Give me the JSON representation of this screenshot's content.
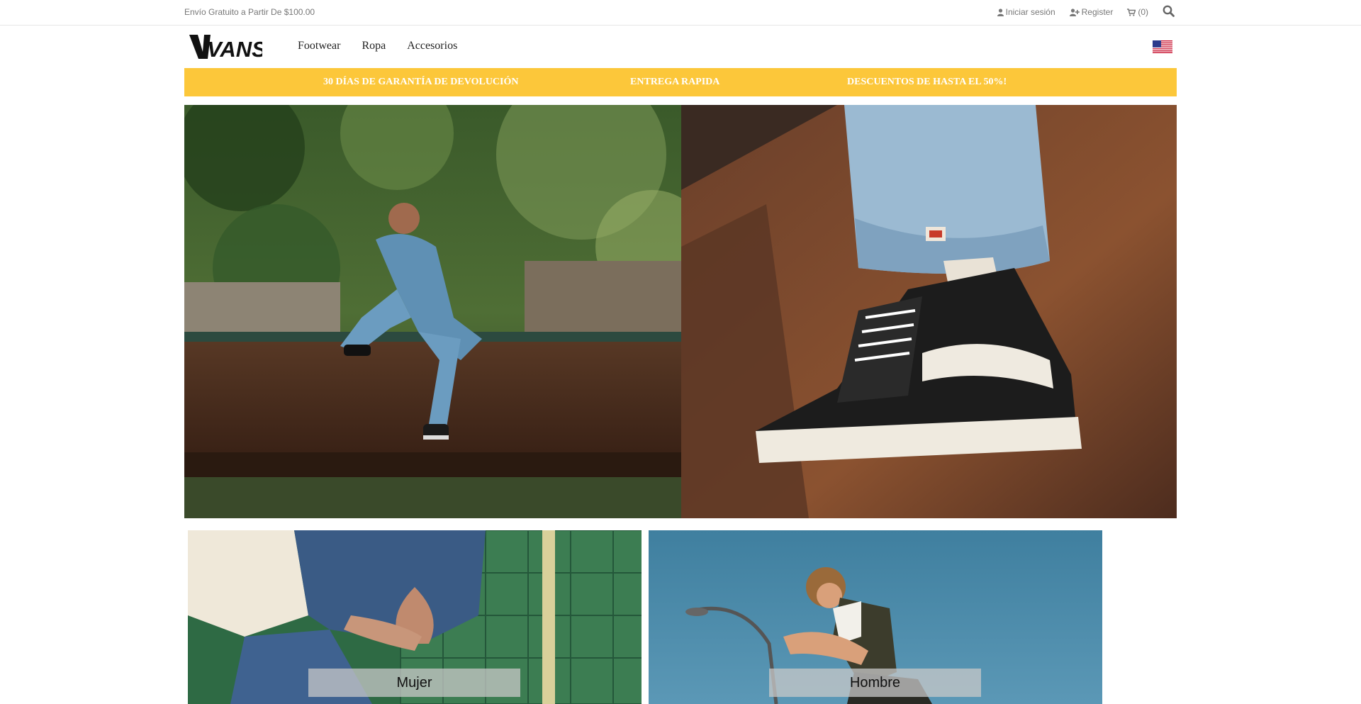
{
  "topbar": {
    "promo": "Envío Gratuito a Partir De $100.00",
    "login": "Iniciar sesión",
    "register": "Register",
    "cart": "(0)"
  },
  "nav": {
    "logo_text": "VANS",
    "items": [
      {
        "label": "Footwear"
      },
      {
        "label": "Ropa"
      },
      {
        "label": "Accesorios"
      }
    ]
  },
  "benefits": [
    {
      "label": "30 DÍAS DE GARANTÍA DE DEVOLUCIÓN"
    },
    {
      "label": "ENTREGA RAPIDA"
    },
    {
      "label": "DESCUENTOS DE HASTA EL 50%!"
    }
  ],
  "categories": [
    {
      "label": "Mujer"
    },
    {
      "label": "Hombre"
    }
  ],
  "icons": {
    "login": "user-icon",
    "register": "user-plus-icon",
    "cart": "cart-icon",
    "search": "search-icon",
    "flag": "us-flag-icon"
  },
  "colors": {
    "accent": "#fcc73a",
    "text_muted": "#777777"
  }
}
